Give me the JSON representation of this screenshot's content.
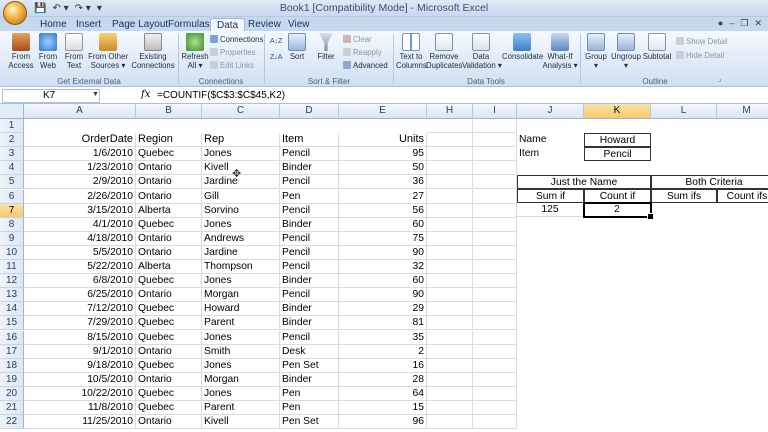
{
  "window": {
    "title": "Book1  [Compatibility Mode]  -  Microsoft Excel"
  },
  "quick_access": [
    "💾",
    "↶ ▾",
    "↷ ▾",
    "▾"
  ],
  "tabs": [
    "Home",
    "Insert",
    "Page Layout",
    "Formulas",
    "Data",
    "Review",
    "View"
  ],
  "active_tab": "Data",
  "ribbon": {
    "get_external": {
      "from_access": "From\nAccess",
      "from_web": "From\nWeb",
      "from_text": "From\nText",
      "from_other": "From Other\nSources ▾",
      "existing": "Existing\nConnections",
      "label": "Get External Data"
    },
    "connections": {
      "refresh": "Refresh\nAll ▾",
      "connections": "Connections",
      "properties": "Properties",
      "edit_links": "Edit Links",
      "label": "Connections"
    },
    "sort_filter": {
      "sort_az": "A↓Z",
      "sort_za": "Z↓A",
      "sort": "Sort",
      "filter": "Filter",
      "clear": "Clear",
      "reapply": "Reapply",
      "advanced": "Advanced",
      "label": "Sort & Filter"
    },
    "data_tools": {
      "text_to_columns": "Text to\nColumns",
      "remove_dupes": "Remove\nDuplicates",
      "validation": "Data\nValidation ▾",
      "consolidate": "Consolidate",
      "whatif": "What-If\nAnalysis ▾",
      "label": "Data Tools"
    },
    "outline": {
      "group": "Group\n▾",
      "ungroup": "Ungroup\n▾",
      "subtotal": "Subtotal",
      "show_detail": "Show Detail",
      "hide_detail": "Hide Detail",
      "label": "Outline"
    }
  },
  "formula_bar": {
    "name_box": "K7",
    "fx": "fx",
    "formula": "=COUNTIF($C$3:$C$45,K2)"
  },
  "columns": [
    "A",
    "B",
    "C",
    "D",
    "E",
    "H",
    "I",
    "J",
    "K",
    "L",
    "M"
  ],
  "selected_column": "K",
  "selected_row": "7",
  "rows": [
    "1",
    "2",
    "3",
    "4",
    "5",
    "6",
    "7",
    "8",
    "9",
    "10",
    "11",
    "12",
    "13",
    "14",
    "15",
    "16",
    "17",
    "18",
    "19",
    "20",
    "21",
    "22"
  ],
  "table": {
    "headers": [
      "OrderDate",
      "Region",
      "Rep",
      "Item",
      "Units"
    ],
    "data": [
      [
        "1/6/2010",
        "Quebec",
        "Jones",
        "Pencil",
        "95"
      ],
      [
        "1/23/2010",
        "Ontario",
        "Kivell",
        "Binder",
        "50"
      ],
      [
        "2/9/2010",
        "Ontario",
        "Jardine",
        "Pencil",
        "36"
      ],
      [
        "2/26/2010",
        "Ontario",
        "Gill",
        "Pen",
        "27"
      ],
      [
        "3/15/2010",
        "Alberta",
        "Sorvino",
        "Pencil",
        "56"
      ],
      [
        "4/1/2010",
        "Quebec",
        "Jones",
        "Binder",
        "60"
      ],
      [
        "4/18/2010",
        "Ontario",
        "Andrews",
        "Pencil",
        "75"
      ],
      [
        "5/5/2010",
        "Ontario",
        "Jardine",
        "Pencil",
        "90"
      ],
      [
        "5/22/2010",
        "Alberta",
        "Thompson",
        "Pencil",
        "32"
      ],
      [
        "6/8/2010",
        "Quebec",
        "Jones",
        "Binder",
        "60"
      ],
      [
        "6/25/2010",
        "Ontario",
        "Morgan",
        "Pencil",
        "90"
      ],
      [
        "7/12/2010",
        "Quebec",
        "Howard",
        "Binder",
        "29"
      ],
      [
        "7/29/2010",
        "Quebec",
        "Parent",
        "Binder",
        "81"
      ],
      [
        "8/15/2010",
        "Quebec",
        "Jones",
        "Pencil",
        "35"
      ],
      [
        "9/1/2010",
        "Ontario",
        "Smith",
        "Desk",
        "2"
      ],
      [
        "9/18/2010",
        "Quebec",
        "Jones",
        "Pen Set",
        "16"
      ],
      [
        "10/5/2010",
        "Ontario",
        "Morgan",
        "Binder",
        "28"
      ],
      [
        "10/22/2010",
        "Quebec",
        "Jones",
        "Pen",
        "64"
      ],
      [
        "11/8/2010",
        "Quebec",
        "Parent",
        "Pen",
        "15"
      ],
      [
        "11/25/2010",
        "Ontario",
        "Kivell",
        "Pen Set",
        "96"
      ]
    ]
  },
  "criteria": {
    "name_label": "Name",
    "name_value": "Howard",
    "item_label": "Item",
    "item_value": "Pencil"
  },
  "summary": {
    "just_name": "Just the Name",
    "both": "Both Criteria",
    "sum_if": "Sum if",
    "count_if": "Count if",
    "sum_ifs": "Sum ifs",
    "count_ifs": "Count ifs",
    "sum_if_value": "125",
    "count_if_value": "2"
  }
}
